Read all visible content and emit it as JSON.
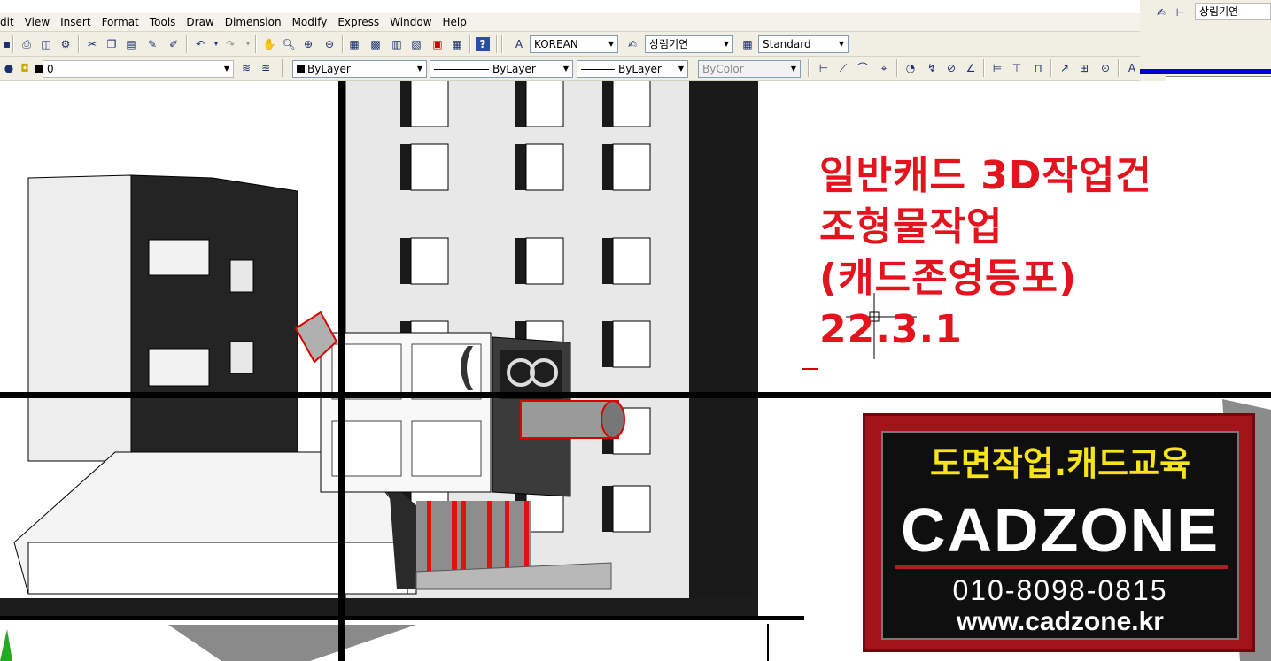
{
  "menu": {
    "items": [
      "dit",
      "View",
      "Insert",
      "Format",
      "Tools",
      "Draw",
      "Dimension",
      "Modify",
      "Express",
      "Window",
      "Help"
    ]
  },
  "toolbar": {
    "text_style": "KOREAN",
    "dim_style": "상림기연",
    "table_style": "Standard",
    "layer": "0",
    "color": "ByLayer",
    "linetype": "ByLayer",
    "lineweight": "ByLayer",
    "plot_style": "ByColor"
  },
  "right_panel": {
    "style_value": "상림기연"
  },
  "overlay": {
    "line1": "일반캐드 3D작업건",
    "line2": "조형물작업",
    "line3": "(캐드존영등포)",
    "line4": "22.3.1"
  },
  "sign": {
    "korean": "도면작업.캐드교육",
    "brand": "CADZONE",
    "phone": "010-8098-0815",
    "website": "www.cadzone.kr"
  },
  "colors": {
    "overlay_text": "#e3141d",
    "sign_background": "#a2141a",
    "sign_korean": "#f6e31c"
  },
  "icons": [
    "save-icon",
    "print-icon",
    "preview-icon",
    "publish-icon",
    "cut-icon",
    "copy-icon",
    "paste-icon",
    "match-properties-icon",
    "undo-icon",
    "redo-icon",
    "pan-icon",
    "zoom-realtime-icon",
    "zoom-window-icon",
    "zoom-previous-icon",
    "properties-icon",
    "design-center-icon",
    "tool-palettes-icon",
    "sheet-set-icon",
    "markup-icon",
    "calculator-icon",
    "help-icon",
    "text-style-icon",
    "dim-style-icon",
    "table-style-icon",
    "layer-icon",
    "layer-previous-icon",
    "linear-dim-icon",
    "aligned-dim-icon",
    "arc-length-icon",
    "ordinate-icon",
    "radius-icon",
    "jogged-icon",
    "diameter-icon",
    "angular-icon",
    "quick-dim-icon",
    "baseline-icon",
    "continue-icon",
    "leader-icon",
    "tolerance-icon",
    "center-mark-icon"
  ]
}
